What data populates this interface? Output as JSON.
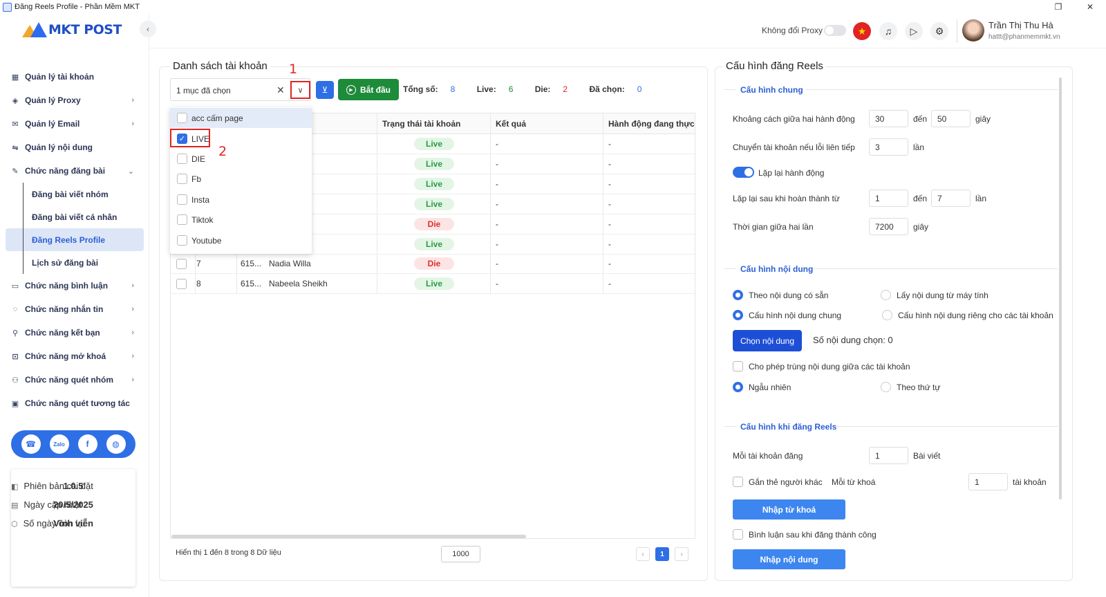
{
  "window": {
    "title": "Đăng Reels Profile - Phần Mềm MKT",
    "restore_icon": "restore-icon",
    "close_icon": "close-icon"
  },
  "logo": {
    "text": "MKT POST"
  },
  "sidebar": {
    "items": [
      {
        "label": "Quản lý tài khoản",
        "icon": "grid-icon",
        "chevron": ""
      },
      {
        "label": "Quản lý Proxy",
        "icon": "layers-icon",
        "chevron": "›"
      },
      {
        "label": "Quản lý Email",
        "icon": "mail-icon",
        "chevron": "›"
      },
      {
        "label": "Quản lý nội dung",
        "icon": "content-icon",
        "chevron": ""
      },
      {
        "label": "Chức năng đăng bài",
        "icon": "edit-icon",
        "chevron": "⌄"
      }
    ],
    "sub_items": [
      {
        "label": "Đăng bài viết nhóm"
      },
      {
        "label": "Đăng bài viết cá nhân"
      },
      {
        "label": "Đăng Reels Profile",
        "active": true
      },
      {
        "label": "Lịch sử đăng bài"
      }
    ],
    "items_after": [
      {
        "label": "Chức năng bình luận",
        "icon": "comment-icon",
        "chevron": "›"
      },
      {
        "label": "Chức năng nhắn tin",
        "icon": "message-icon",
        "chevron": "›"
      },
      {
        "label": "Chức năng kết bạn",
        "icon": "add-friend-icon",
        "chevron": "›"
      },
      {
        "label": "Chức năng mở khoá",
        "icon": "lock-icon",
        "chevron": "›"
      },
      {
        "label": "Chức năng quét nhóm",
        "icon": "group-icon",
        "chevron": "›"
      },
      {
        "label": "Chức năng quét tương tác",
        "icon": "scan-icon",
        "chevron": ""
      }
    ],
    "social": {
      "zalo": "Zalo"
    },
    "info": {
      "version_label": "Phiên bản cài đặt",
      "version": "1.0.5",
      "update_label": "Ngày cập nhật",
      "update": "20/5/2025",
      "days_label": "Số ngày còn lại",
      "days": "Vĩnh viễn"
    }
  },
  "header": {
    "proxy_label": "Không đổi Proxy",
    "user_name": "Trần Thị Thu Hà",
    "user_email": "hattt@phanmemmkt.vn"
  },
  "accounts": {
    "title": "Danh sách tài khoản",
    "filter_value": "1 mục đã chọn",
    "start_label": "Bắt đầu",
    "stats": {
      "total_label": "Tổng số:",
      "total": "8",
      "live_label": "Live:",
      "live": "6",
      "die_label": "Die:",
      "die": "2",
      "selected_label": "Đã chọn:",
      "selected": "0"
    },
    "annotations": {
      "one": "1",
      "two": "2"
    },
    "columns": [
      "Trạng thái tài khoản",
      "Kết quả",
      "Hành động đang thực h"
    ],
    "rows": [
      {
        "status": "Live",
        "result": "-",
        "action": "-"
      },
      {
        "status": "Live",
        "result": "-",
        "action": "-"
      },
      {
        "status": "Live",
        "result": "-",
        "action": "-"
      },
      {
        "status": "Live",
        "result": "-",
        "action": "-"
      },
      {
        "status": "Die",
        "result": "-",
        "action": "-"
      },
      {
        "status": "Live",
        "result": "-",
        "action": "-"
      },
      {
        "stt": "7",
        "uid": "615...",
        "name": "Nadia Willa",
        "status": "Die",
        "result": "-",
        "action": "-"
      },
      {
        "stt": "8",
        "uid": "615...",
        "name": "Nabeela Sheikh",
        "status": "Live",
        "result": "-",
        "action": "-"
      }
    ],
    "dropdown": [
      {
        "label": "acc cấm page",
        "checked": false
      },
      {
        "label": "LIVE",
        "checked": true
      },
      {
        "label": "DIE",
        "checked": false
      },
      {
        "label": "Fb",
        "checked": false
      },
      {
        "label": "Insta",
        "checked": false
      },
      {
        "label": "Tiktok",
        "checked": false
      },
      {
        "label": "Youtube",
        "checked": false
      }
    ],
    "footer_text": "Hiển thị 1 đến 8 trong 8 Dữ liệu",
    "page_size": "1000",
    "page": "1"
  },
  "config": {
    "title": "Cấu hình đăng Reels",
    "general": {
      "title": "Cấu hình chung",
      "interval_label": "Khoảng cách giữa hai hành động",
      "interval_from": "30",
      "to_label": "đến",
      "interval_to": "50",
      "sec_label": "giây",
      "switch_label": "Chuyển tài khoản nếu lỗi liên tiếp",
      "switch_value": "3",
      "times_label": "lần",
      "repeat_label": "Lặp lại hành động",
      "repeat_after_label": "Lặp lại sau khi hoàn thành từ",
      "repeat_from": "1",
      "repeat_to": "7",
      "between_label": "Thời gian giữa hai lần",
      "between_value": "7200"
    },
    "content": {
      "title": "Cấu hình nội dung",
      "opt_available": "Theo nội dung có sẵn",
      "opt_computer": "Lấy nội dung từ máy tính",
      "opt_common": "Cấu hình nội dung chung",
      "opt_separate": "Cấu hình nội dung riêng cho các tài khoản",
      "choose_btn": "Chọn nội dung",
      "count_label": "Số nội dung chọn: 0",
      "allow_dup": "Cho phép trùng nội dung giữa các tài khoản",
      "random": "Ngẫu nhiên",
      "ordered": "Theo thứ tự"
    },
    "reels": {
      "title": "Cấu hình khi đăng Reels",
      "per_account_label": "Mỗi tài khoản đăng",
      "per_account_value": "1",
      "post_label": "Bài viết",
      "tag_label": "Gắn thẻ người khác",
      "keyword_label": "Mỗi từ khoá",
      "keyword_value": "1",
      "account_label": "tài khoản",
      "import_keyword_btn": "Nhập từ khoá",
      "comment_label": "Bình luận sau khi đăng thành công",
      "import_content_btn": "Nhập nội dung"
    }
  }
}
